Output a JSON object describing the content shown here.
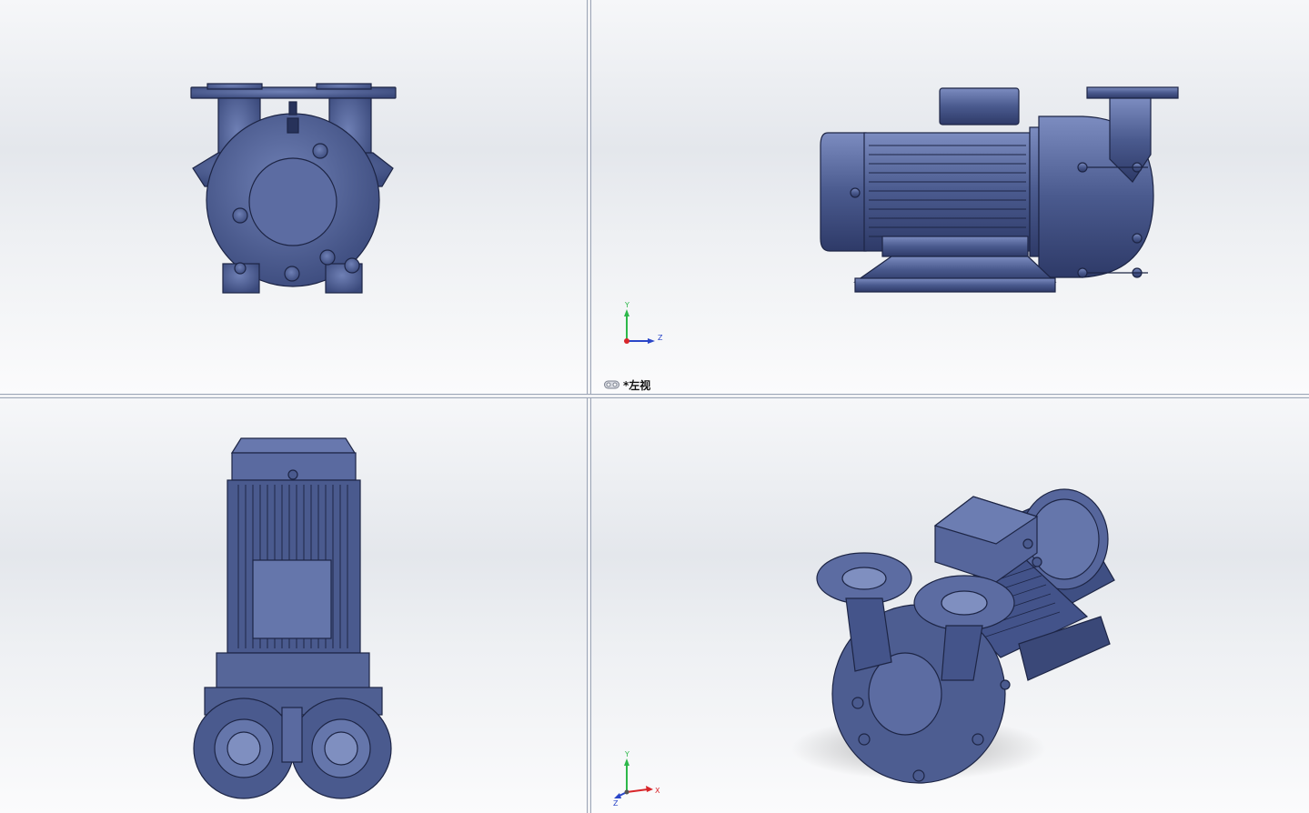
{
  "active_view_label": "*左视",
  "viewports": [
    {
      "name": "front-view"
    },
    {
      "name": "left-view"
    },
    {
      "name": "top-view"
    },
    {
      "name": "isometric-view"
    }
  ],
  "triad_left": {
    "axes": [
      {
        "label": "Y",
        "color": "#2db84a"
      },
      {
        "label": "Z",
        "color": "#2a46c8"
      }
    ]
  },
  "triad_iso": {
    "axes": [
      {
        "label": "Y",
        "color": "#2db84a"
      },
      {
        "label": "X",
        "color": "#d8262a"
      },
      {
        "label": "Z",
        "color": "#2a46c8"
      }
    ]
  },
  "colors": {
    "model_fill": "#4a5a8e",
    "model_light": "#6c7db2",
    "model_dark": "#27325a",
    "splitter": "#9aa3b5"
  },
  "icons": {
    "camera": "glasses-camera-icon"
  }
}
